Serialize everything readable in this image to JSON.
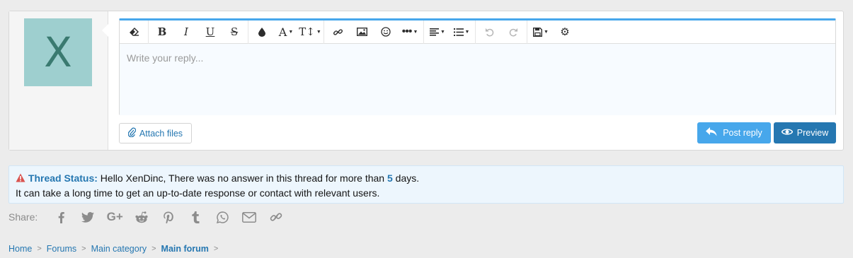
{
  "user": {
    "avatar_letter": "X"
  },
  "editor": {
    "placeholder": "Write your reply...",
    "toolbar": [
      "eraser-icon",
      "bold-icon",
      "italic-icon",
      "underline-icon",
      "strikethrough-icon",
      "text-color-icon",
      "font-family-icon",
      "font-size-icon",
      "link-icon",
      "image-icon",
      "smilie-icon",
      "more-options-icon",
      "align-icon",
      "list-icon",
      "undo-icon",
      "redo-icon",
      "drafts-icon",
      "settings-icon"
    ]
  },
  "actions": {
    "attach_label": "Attach files",
    "post_reply_label": "Post reply",
    "preview_label": "Preview"
  },
  "notice": {
    "title": "Thread Status:",
    "text_before": "Hello XenDinc, There was no answer in this thread for more than",
    "days": "5",
    "text_after": "days.",
    "line2": "It can take a long time to get an up-to-date response or contact with relevant users."
  },
  "share": {
    "label": "Share:",
    "icons": [
      "facebook-icon",
      "twitter-icon",
      "google-plus-icon",
      "reddit-icon",
      "pinterest-icon",
      "tumblr-icon",
      "whatsapp-icon",
      "email-icon",
      "link-icon"
    ]
  },
  "breadcrumb": {
    "items": [
      "Home",
      "Forums",
      "Main category",
      "Main forum"
    ]
  },
  "colors": {
    "accent": "#47a7eb",
    "link": "#2577b1",
    "avatar_bg": "#9ecfcf",
    "warning": "#d9534f"
  }
}
